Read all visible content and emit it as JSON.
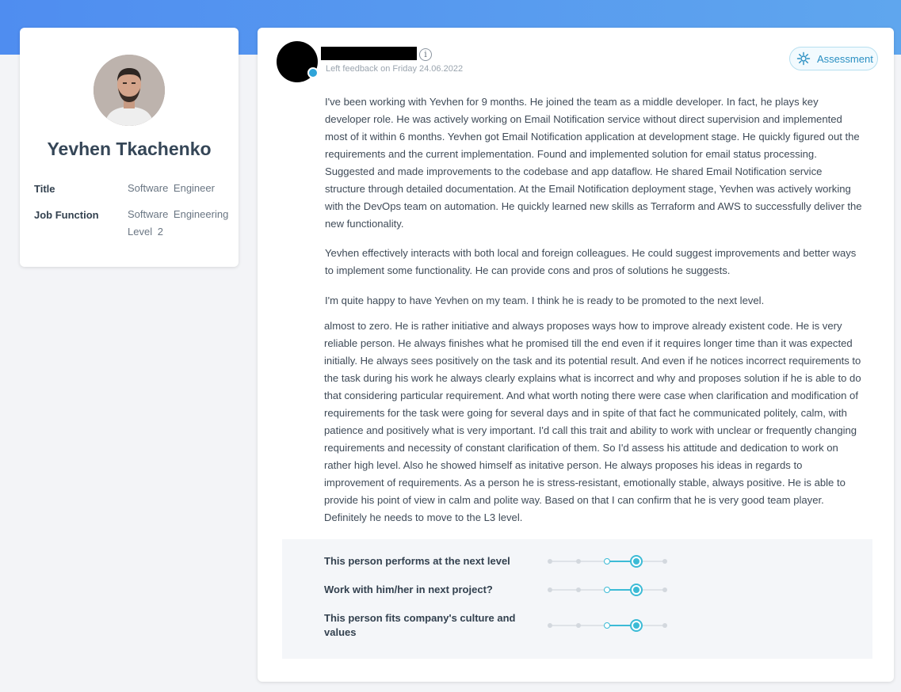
{
  "profile": {
    "name": "Yevhen Tkachenko",
    "fields": [
      {
        "label": "Title",
        "value": "Software Engineer"
      },
      {
        "label": "Job Function",
        "value": "Software Engineering Level 2"
      }
    ]
  },
  "feedback": {
    "date_text": "Left feedback on Friday 24.06.2022",
    "assessment_label": "Assessment",
    "paragraphs": [
      "I've been working with Yevhen for 9 months. He joined the team as a middle developer. In fact, he plays key developer role. He was actively working on Email Notification service without direct supervision and implemented most of it within 6 months. Yevhen got Email Notification application at development stage. He quickly figured out the requirements and the current implementation. Found and implemented solution for email status processing. Suggested and made improvements to the codebase and app dataflow. He shared Email Notification service structure through detailed documentation. At the Email Notification deployment stage, Yevhen was actively working with the DevOps team on automation. He quickly learned new skills as Terraform and AWS to successfully deliver the new functionality.",
      "Yevhen effectively interacts with both local and foreign colleagues. He could suggest improvements and better ways to implement some functionality. He can provide cons and pros of solutions he suggests.",
      "I'm quite happy to have Yevhen on my team. I think he is ready to be promoted to the next level.",
      "almost to zero. He is rather initiative and always proposes ways how to improve already existent code. He is very reliable person. He always finishes what he promised till the end even if it requires longer time than it was expected initially. He always sees positively on the task and its potential result. And even if he notices incorrect requirements to the task during his work he always clearly explains what is incorrect and why and proposes solution if he is able to do that considering particular requirement. And what worth noting there were case when clarification and modification of requirements for the task were going for several days and in spite of that fact he communicated politely, calm, with patience and positively what is very important. I'd call this trait and ability to work with unclear or frequently changing requirements and necessity of constant clarification of them. So I'd assess his attitude and dedication to work on rather high level. Also he showed himself as initative person. He always proposes his ideas in regards to improvement of requirements. As a person he is stress-resistant, emotionally stable, always positive. He is able to provide his point of view in calm and polite way. Based on that I can confirm that he is very good team player. Definitely he needs to move to the L3 level."
    ],
    "ratings": [
      {
        "label": "This person performs at the next level",
        "value": 4,
        "max": 5
      },
      {
        "label": "Work with him/her in next project?",
        "value": 4,
        "max": 5
      },
      {
        "label": "This person fits company's culture and values",
        "value": 4,
        "max": 5
      }
    ]
  },
  "colors": {
    "header_gradient_start": "#4f8df0",
    "header_gradient_end": "#5fa6ee",
    "accent": "#3cbbd6",
    "assessment_text": "#2a8fc2"
  },
  "icons": {
    "info": "info-icon",
    "assessment": "gear-icon",
    "verified": "verified-badge-icon"
  }
}
